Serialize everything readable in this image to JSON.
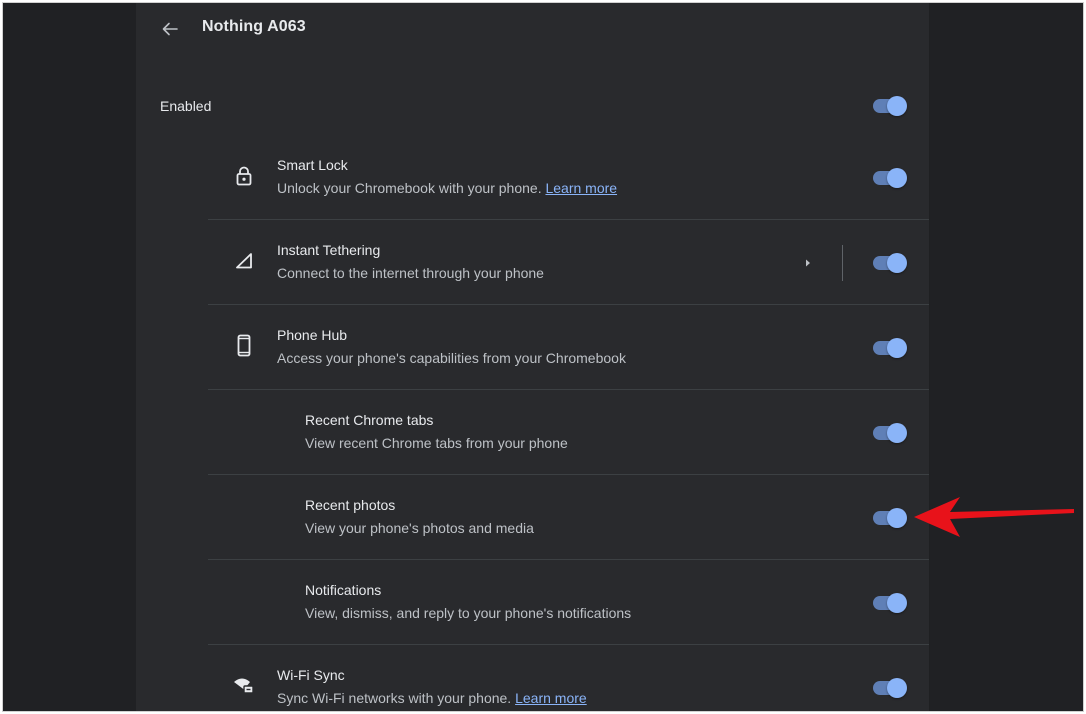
{
  "header": {
    "title": "Nothing A063",
    "back_icon": "arrow-back-icon"
  },
  "enabled": {
    "label": "Enabled",
    "on": true
  },
  "features": [
    {
      "icon": "lock-icon",
      "title": "Smart Lock",
      "subtitle": "Unlock your Chromebook with your phone.",
      "link": "Learn more",
      "on": true
    },
    {
      "icon": "signal-icon",
      "title": "Instant Tethering",
      "subtitle": "Connect to the internet through your phone",
      "on": true
    },
    {
      "icon": "phone-icon",
      "title": "Phone Hub",
      "subtitle": "Access your phone's capabilities from your Chromebook",
      "on": true
    },
    {
      "title": "Recent Chrome tabs",
      "subtitle": "View recent Chrome tabs from your phone",
      "on": true
    },
    {
      "title": "Recent photos",
      "subtitle": "View your phone's photos and media",
      "on": true
    },
    {
      "title": "Notifications",
      "subtitle": "View, dismiss, and reply to your phone's notifications",
      "on": true
    },
    {
      "icon": "wifi-sync-icon",
      "title": "Wi-Fi Sync",
      "subtitle": "Sync Wi-Fi networks with your phone.",
      "link": "Learn more",
      "on": true
    }
  ],
  "colors": {
    "accent": "#8ab4f8",
    "annotation_arrow": "#e8121a"
  }
}
